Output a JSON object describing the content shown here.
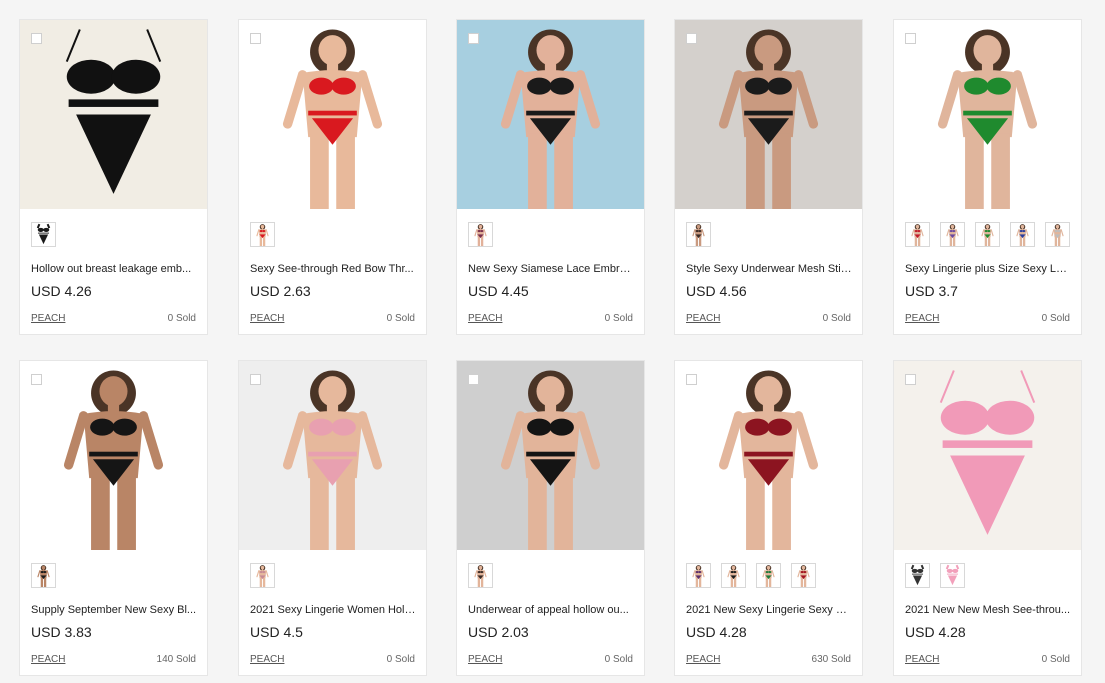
{
  "products": [
    {
      "title": "Hollow out breast leakage emb...",
      "price": "USD 4.26",
      "shop": "PEACH",
      "sold": "0 Sold",
      "image": "black-lingerie-photo",
      "bg": "#f1ede4",
      "garment": "#111111",
      "skin": "",
      "swatches": [
        "#1a1a1a"
      ]
    },
    {
      "title": "Sexy See-through Red Bow Thr...",
      "price": "USD 2.63",
      "shop": "PEACH",
      "sold": "0 Sold",
      "image": "red-bow-lingerie-photo",
      "bg": "#ffffff",
      "garment": "#d9191f",
      "skin": "#e8b99b",
      "swatches": [
        "#d9191f"
      ]
    },
    {
      "title": "New Sexy Siamese Lace Embroi...",
      "price": "USD 4.45",
      "shop": "PEACH",
      "sold": "0 Sold",
      "image": "butterfly-lingerie-photo",
      "bg": "#a7cfe0",
      "garment": "#1a1a1a",
      "skin": "#e2b19a",
      "swatches": [
        "#7a2f4b"
      ]
    },
    {
      "title": "Style Sexy Underwear Mesh Stit...",
      "price": "USD 4.56",
      "shop": "PEACH",
      "sold": "0 Sold",
      "image": "lace-dress-photo",
      "bg": "#d4d0cc",
      "garment": "#1b1b1b",
      "skin": "#c99a80",
      "swatches": [
        "#3b2b26"
      ]
    },
    {
      "title": "Sexy Lingerie plus Size Sexy Lac...",
      "price": "USD 3.7",
      "shop": "PEACH",
      "sold": "0 Sold",
      "image": "green-babydoll-photo",
      "bg": "#ffffff",
      "garment": "#1f8a2e",
      "skin": "#e0b59c",
      "swatches": [
        "#c21c2a",
        "#6b4aa0",
        "#1f8a2e",
        "#2a3e9e",
        "#bdbdbd"
      ]
    },
    {
      "title": "Supply September New Sexy Bl...",
      "price": "USD 3.83",
      "shop": "PEACH",
      "sold": "140 Sold",
      "image": "mesh-set-photo",
      "bg": "#ffffff",
      "garment": "#151515",
      "skin": "#b98566",
      "swatches": [
        "#1b1b1b"
      ]
    },
    {
      "title": "2021 Sexy Lingerie Women Holl...",
      "price": "USD 4.5",
      "shop": "PEACH",
      "sold": "0 Sold",
      "image": "floral-lingerie-photo",
      "bg": "#eeeeee",
      "garment": "#e8a0b0",
      "skin": "#e6b89c",
      "swatches": [
        "#c78a94"
      ]
    },
    {
      "title": "Underwear of appeal hollow ou...",
      "price": "USD 2.03",
      "shop": "PEACH",
      "sold": "0 Sold",
      "image": "black-bodysuit-photo",
      "bg": "#cfcfcf",
      "garment": "#141414",
      "skin": "#e2b49a",
      "swatches": [
        "#3a2a24"
      ]
    },
    {
      "title": "2021 New Sexy Lingerie Sexy Sl...",
      "price": "USD 4.28",
      "shop": "PEACH",
      "sold": "630 Sold",
      "image": "burgundy-garter-photo",
      "bg": "#ffffff",
      "garment": "#8c1420",
      "skin": "#e3b69c",
      "swatches": [
        "#5a2e6a",
        "#1a1a1a",
        "#1f7a3a",
        "#a3141f"
      ]
    },
    {
      "title": "2021 New New Mesh See-throu...",
      "price": "USD 4.28",
      "shop": "PEACH",
      "sold": "0 Sold",
      "image": "pink-garter-set-photo",
      "bg": "#f4f1ec",
      "garment": "#f19ab8",
      "skin": "",
      "swatches": [
        "#333333",
        "#f2a0bb"
      ]
    }
  ]
}
